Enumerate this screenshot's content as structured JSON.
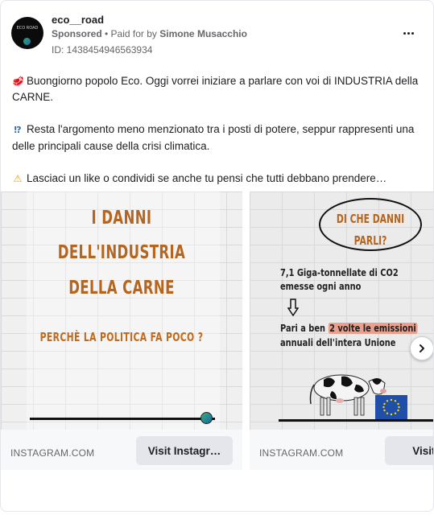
{
  "header": {
    "page_name": "eco__road",
    "avatar_text": "ECO ROAD",
    "sponsored": "Sponsored",
    "paid_prefix": "• Paid for by",
    "paid_by": "Simone Musacchio",
    "ad_id": "ID: 1438454946563934",
    "more_icon": "more-horizontal-icon"
  },
  "post": {
    "paragraph_1": "Buongiorno popolo Eco. Oggi vorrei iniziare a parlare con voi di INDUSTRIA della CARNE.",
    "paragraph_2": "Resta l'argomento meno menzionato tra i posti di potere, seppur rappresenti una delle principali cause della crisi climatica.",
    "paragraph_3": "Lasciaci un like o condividi se anche tu pensi che tutti debbano prendere…",
    "emoji_1": "🥩",
    "emoji_2": "⁉",
    "emoji_3": "⚠"
  },
  "carousel": {
    "slides": [
      {
        "title_lines": [
          "I DANNI",
          "DELL'INDUSTRIA",
          "DELLA CARNE"
        ],
        "subtitle": "PERCHÈ LA POLITICA FA POCO ?",
        "domain": "INSTAGRAM.COM",
        "cta": "Visit Instagr…"
      },
      {
        "bubble_lines": [
          "DI CHE DANNI",
          "PARLI?"
        ],
        "line_1": "7,1 Giga-tonnellate di CO2",
        "line_2": "emesse ogni anno",
        "line_3_pre": "Pari a ben ",
        "line_3_highlight": "2 volte le emissioni",
        "line_4": "annuali dell'intera Unione",
        "domain": "INSTAGRAM.COM",
        "cta": "Visit Ins"
      }
    ],
    "next_icon": "chevron-right-icon"
  },
  "colors": {
    "accent_text": "#b5651d",
    "highlight": "#e9a08e",
    "eu_blue": "#1f4fa8"
  }
}
